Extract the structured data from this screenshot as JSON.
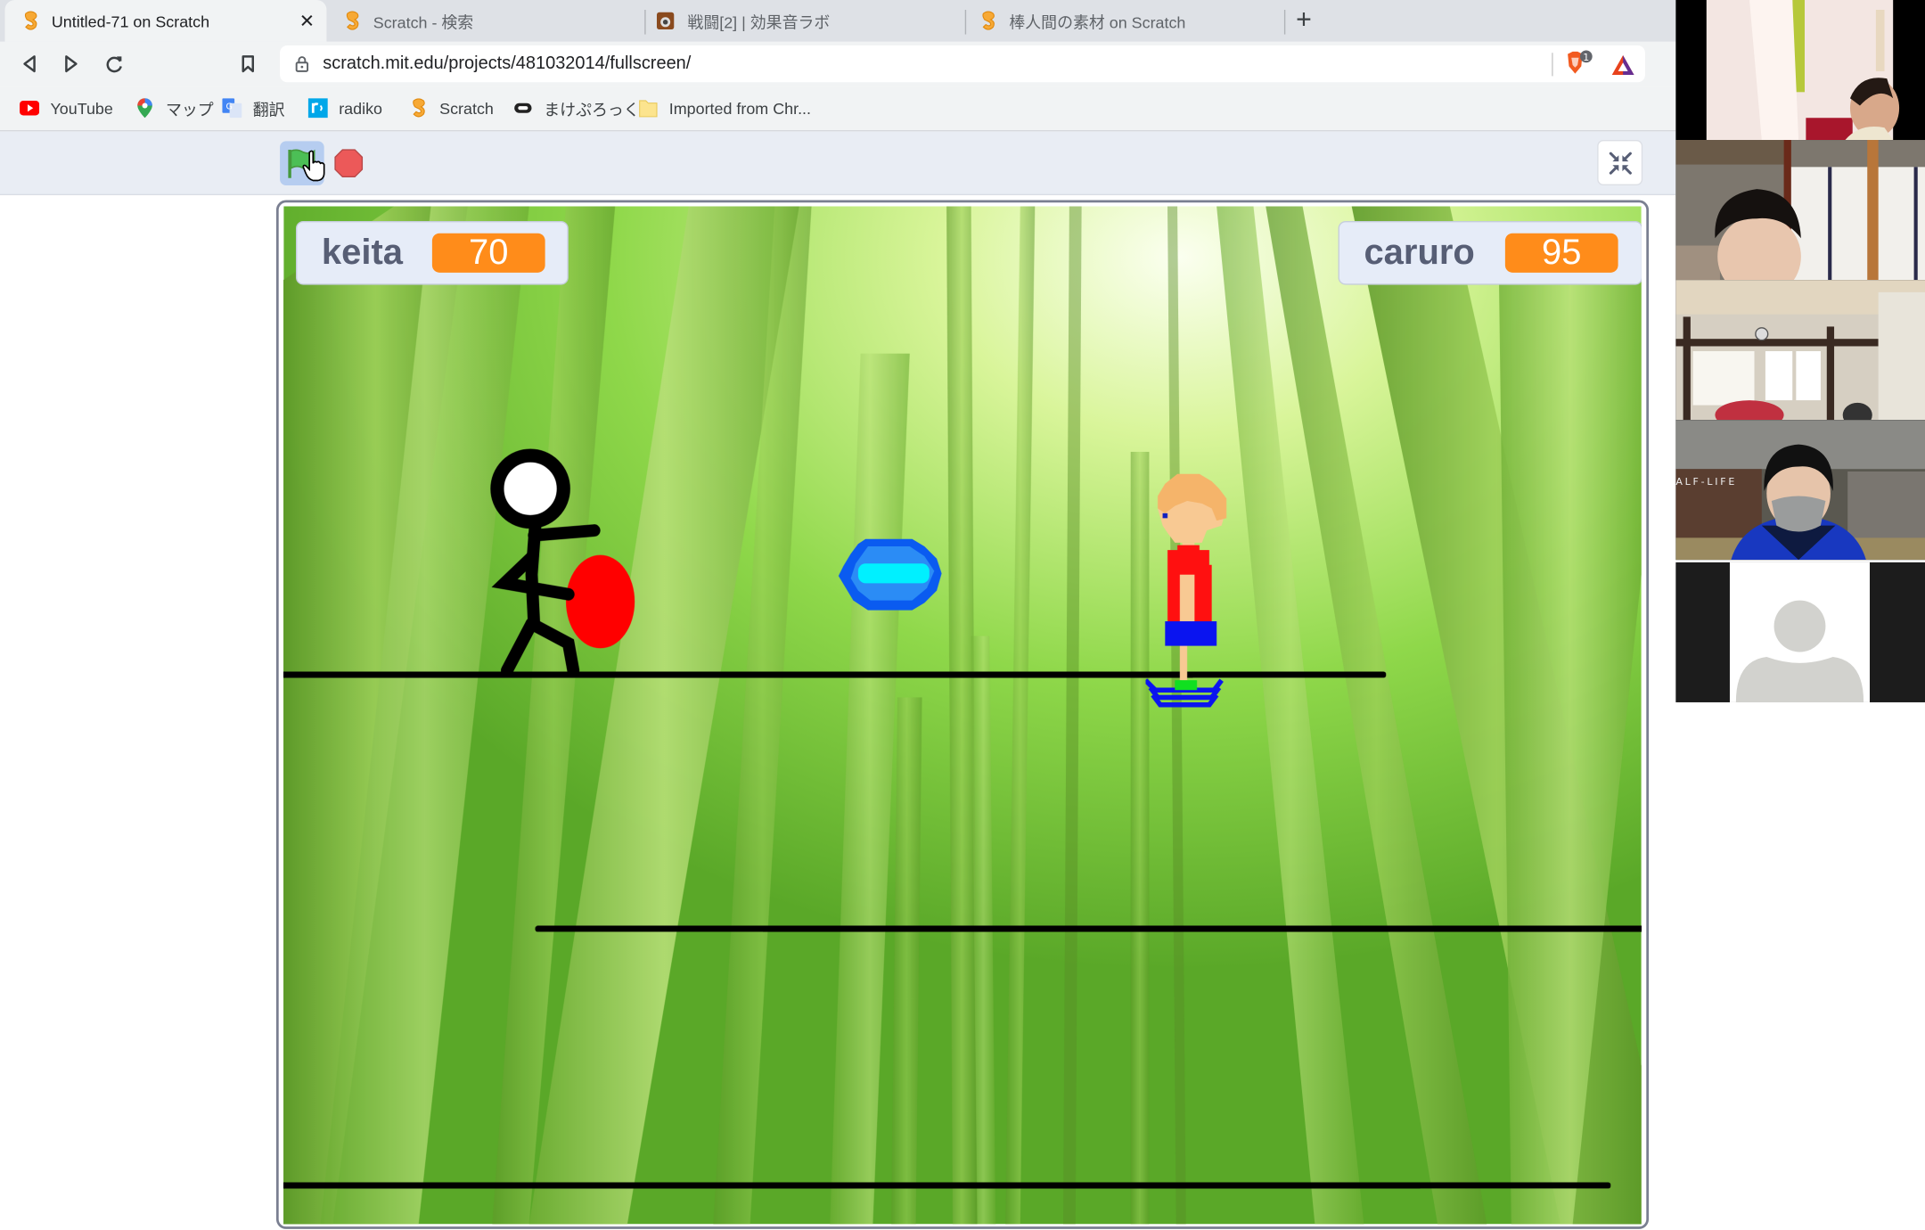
{
  "browser": {
    "tabs": [
      {
        "title": "Untitled-71 on Scratch",
        "icon": "scratch-favicon",
        "active": true,
        "close_label": "✕"
      },
      {
        "title": "Scratch - 検索",
        "icon": "scratch-favicon",
        "active": false
      },
      {
        "title": "戦闘[2] | 効果音ラボ",
        "icon": "speaker-favicon",
        "active": false
      },
      {
        "title": "棒人間の素材 on Scratch",
        "icon": "scratch-favicon",
        "active": false
      }
    ],
    "new_tab_label": "+",
    "url": "scratch.mit.edu/projects/481032014/fullscreen/",
    "extensions": [
      {
        "name": "brave-shields-icon",
        "badge": "1"
      },
      {
        "name": "brave-rewards-icon"
      }
    ],
    "bookmarks": [
      {
        "label": "YouTube",
        "icon": "youtube-icon"
      },
      {
        "label": "マップ",
        "icon": "maps-icon"
      },
      {
        "label": "翻訳",
        "icon": "translate-icon"
      },
      {
        "label": "radiko",
        "icon": "radiko-icon"
      },
      {
        "label": "Scratch",
        "icon": "scratch-favicon"
      },
      {
        "label": "まけぷろっく",
        "icon": "makeblock-icon"
      },
      {
        "label": "Imported from Chr...",
        "icon": "folder-icon"
      }
    ]
  },
  "scratch": {
    "controls": {
      "green_flag": "green-flag-icon",
      "stop": "stop-icon",
      "fullscreen_exit": "unfullscreen-icon"
    },
    "monitors": [
      {
        "label": "keita",
        "value": "70"
      },
      {
        "label": "caruro",
        "value": "95"
      }
    ],
    "sprites": [
      {
        "name": "stick-figure-keita",
        "shield_color": "#ff0000"
      },
      {
        "name": "blue-energy-ball",
        "colors": [
          "#0a5bf0",
          "#2b8cf5",
          "#00f0ff"
        ]
      },
      {
        "name": "pixel-character-caruro",
        "colors": {
          "hair": "#f5b46a",
          "skin": "#f8c993",
          "shirt": "#ff1010",
          "shorts": "#0a14f0",
          "platform": "#0a14f0",
          "gem": "#10e020"
        }
      }
    ],
    "backdrop": "bamboo-forest"
  },
  "video_call": {
    "participants": [
      {
        "name": "participant-1",
        "type": "video"
      },
      {
        "name": "participant-2",
        "type": "video"
      },
      {
        "name": "participant-3",
        "type": "video"
      },
      {
        "name": "participant-4",
        "type": "video",
        "background_text": "ALF-LIFE"
      },
      {
        "name": "participant-5",
        "type": "avatar-placeholder"
      }
    ]
  }
}
